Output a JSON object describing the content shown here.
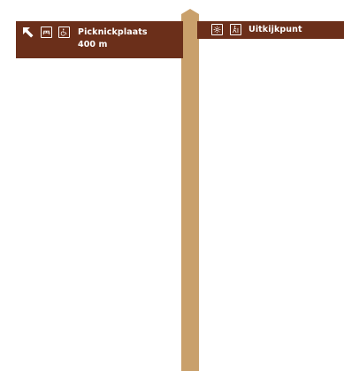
{
  "signpost": {
    "colors": {
      "board": "#6b2f1a",
      "post": "#c9a06b",
      "text": "#ffffff"
    },
    "left_sign": {
      "direction_icon": "arrow-up-left-icon",
      "icons": [
        "picnic-table-icon",
        "wheelchair-icon"
      ],
      "destination": "Picknickplaats",
      "distance": "400 m"
    },
    "right_sign": {
      "icons": [
        "viewpoint-icon",
        "hiking-icon"
      ],
      "destination": "Uitkijkpunt"
    }
  }
}
